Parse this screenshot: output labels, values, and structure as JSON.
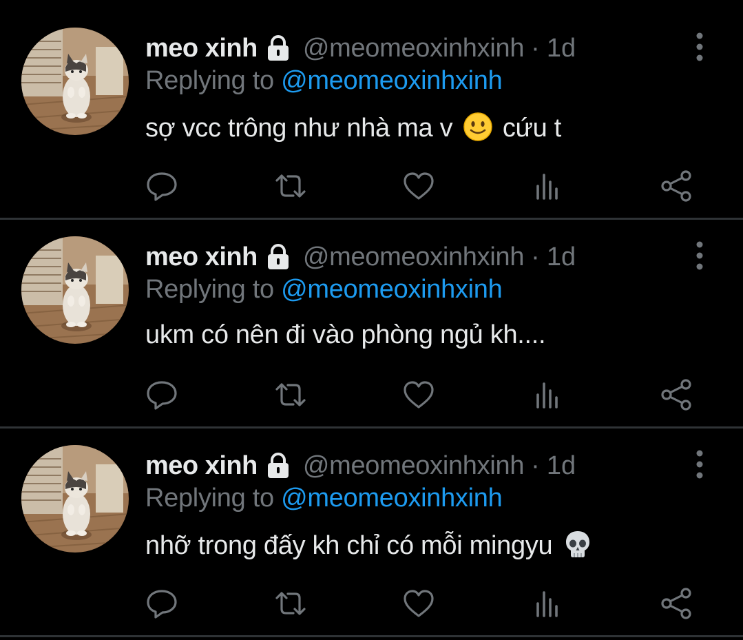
{
  "colors": {
    "background": "#000000",
    "primary_text": "#e7e9ea",
    "secondary_text": "#71767b",
    "link": "#1d9bf0",
    "divider": "#2f3336"
  },
  "tweets": [
    {
      "display_name": "meo xinh",
      "protected_icon": "lock-icon",
      "handle": "@meomeoxinhxinh",
      "separator": "·",
      "time": "1d",
      "reply_prefix": "Replying to",
      "reply_to": "@meomeoxinhxinh",
      "text_before_emoji": "sợ vcc trông như nhà ma v",
      "emoji": "slightly-smiling-face-emoji",
      "text_after_emoji": "cứu t",
      "actions": [
        "reply-icon",
        "retweet-icon",
        "like-icon",
        "stats-icon",
        "share-icon"
      ]
    },
    {
      "display_name": "meo xinh",
      "protected_icon": "lock-icon",
      "handle": "@meomeoxinhxinh",
      "separator": "·",
      "time": "1d",
      "reply_prefix": "Replying to",
      "reply_to": "@meomeoxinhxinh",
      "text_before_emoji": "ukm có nên đi vào phòng ngủ kh....",
      "emoji": "",
      "text_after_emoji": "",
      "actions": [
        "reply-icon",
        "retweet-icon",
        "like-icon",
        "stats-icon",
        "share-icon"
      ]
    },
    {
      "display_name": "meo xinh",
      "protected_icon": "lock-icon",
      "handle": "@meomeoxinhxinh",
      "separator": "·",
      "time": "1d",
      "reply_prefix": "Replying to",
      "reply_to": "@meomeoxinhxinh",
      "text_before_emoji": "nhỡ trong đấy kh chỉ có mỗi mingyu",
      "emoji": "skull-emoji",
      "text_after_emoji": "",
      "actions": [
        "reply-icon",
        "retweet-icon",
        "like-icon",
        "stats-icon",
        "share-icon"
      ]
    }
  ]
}
